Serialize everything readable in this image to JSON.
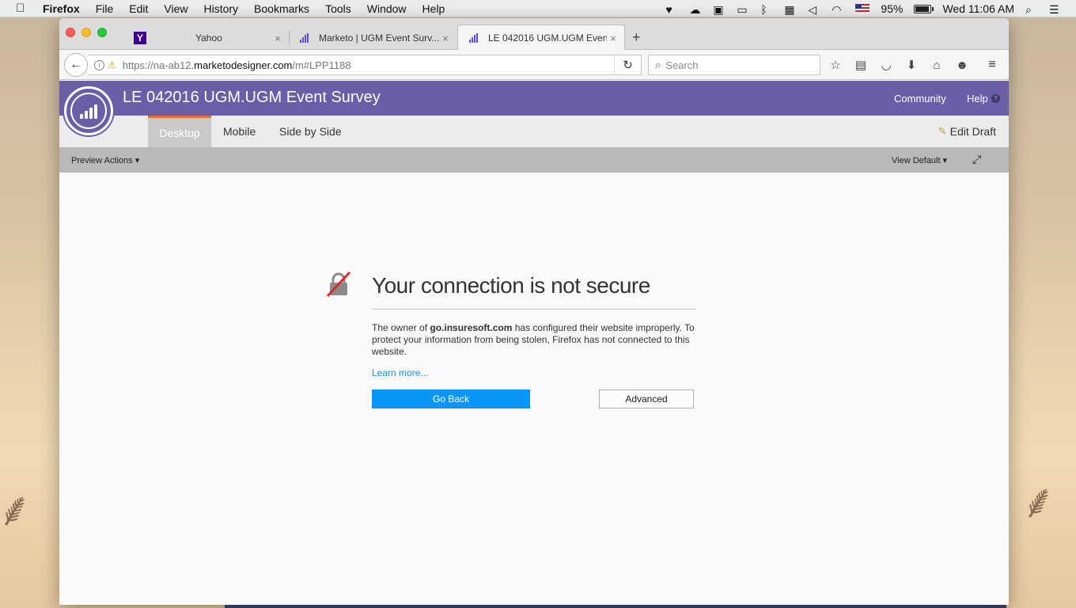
{
  "menubar": {
    "app_name": "Firefox",
    "items": [
      "File",
      "Edit",
      "View",
      "History",
      "Bookmarks",
      "Tools",
      "Window",
      "Help"
    ],
    "battery_percent": "95%",
    "battery_level": 0.95,
    "clock": "Wed 11:06 AM"
  },
  "tabs": [
    {
      "title": "Yahoo",
      "favicon": "yahoo-icon",
      "close": "×"
    },
    {
      "title": "Marketo | UGM Event Surv...",
      "favicon": "marketo-icon",
      "close": "×"
    },
    {
      "title": "LE 042016 UGM.UGM Even...",
      "favicon": "marketo-icon",
      "close": "×"
    }
  ],
  "new_tab_label": "+",
  "navbar": {
    "url_prefix": "https://na-ab12.",
    "url_host": "marketodesigner.com",
    "url_path": "/m#LPP1188",
    "search_placeholder": "Search"
  },
  "app": {
    "title": "LE 042016 UGM.UGM Event Survey",
    "community": "Community",
    "help": "Help",
    "tabs": [
      "Desktop",
      "Mobile",
      "Side by Side"
    ],
    "edit_draft": "Edit Draft",
    "preview_actions": "Preview Actions ▾",
    "view_default": "View Default ▾",
    "brand_color": "#6a5ea9",
    "tab_accent": "#e0732a"
  },
  "error": {
    "title": "Your connection is not secure",
    "desc_before": "The owner of ",
    "desc_host": "go.insuresoft.com",
    "desc_after": " has configured their website improperly. To protect your information from being stolen, Firefox has not connected to this website.",
    "learn_more": "Learn more...",
    "go_back": "Go Back",
    "advanced": "Advanced",
    "button_color": "#0996f8"
  }
}
